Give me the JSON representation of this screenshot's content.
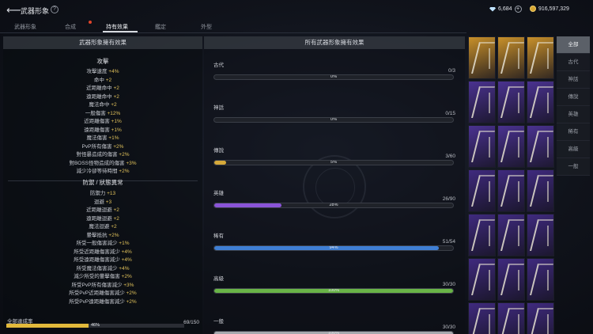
{
  "header": {
    "back_icon": "arrow-left-icon",
    "title": "武器形象",
    "help": "?",
    "diamonds": "6,684",
    "gold": "916,597,329"
  },
  "tabs": [
    {
      "label": "武器形象",
      "active": false
    },
    {
      "label": "合成",
      "active": false
    },
    {
      "label": "持有效果",
      "active": true
    },
    {
      "label": "鑑定",
      "active": false
    },
    {
      "label": "外型",
      "active": false
    }
  ],
  "left_panel": {
    "header": "武器形象擁有效果",
    "attack": {
      "title": "攻擊",
      "stats": [
        {
          "name": "攻擊速度",
          "value": "+4%"
        },
        {
          "name": "命中",
          "value": "+2"
        },
        {
          "name": "近距離命中",
          "value": "+2"
        },
        {
          "name": "遠距離命中",
          "value": "+2"
        },
        {
          "name": "魔法命中",
          "value": "+2"
        },
        {
          "name": "一般傷害",
          "value": "+12%"
        },
        {
          "name": "近距離傷害",
          "value": "+1%"
        },
        {
          "name": "遠距離傷害",
          "value": "+1%"
        },
        {
          "name": "魔法傷害",
          "value": "+1%"
        },
        {
          "name": "PvP所有傷害",
          "value": "+2%"
        },
        {
          "name": "對怪暴造成的傷害",
          "value": "+2%"
        },
        {
          "name": "對BOSS怪物造成的傷害",
          "value": "+3%"
        },
        {
          "name": "減少冷卻等待時間",
          "value": "+2%"
        }
      ]
    },
    "defense": {
      "title": "防禦 / 狀態異常",
      "stats": [
        {
          "name": "防禦力",
          "value": "+13"
        },
        {
          "name": "迴避",
          "value": "+3"
        },
        {
          "name": "近距離迴避",
          "value": "+2"
        },
        {
          "name": "遠距離迴避",
          "value": "+2"
        },
        {
          "name": "魔法迴避",
          "value": "+2"
        },
        {
          "name": "暈擊抵抗",
          "value": "+2%"
        },
        {
          "name": "所受一般傷害減少",
          "value": "+1%"
        },
        {
          "name": "所受近距離傷害減少",
          "value": "+4%"
        },
        {
          "name": "所受遠距離傷害減少",
          "value": "+4%"
        },
        {
          "name": "所受魔法傷害減少",
          "value": "+4%"
        },
        {
          "name": "減少所受的暈擊傷害",
          "value": "+2%"
        },
        {
          "name": "所受PvP所有傷害減少",
          "value": "+3%"
        },
        {
          "name": "所受PvP近距離傷害減少",
          "value": "+2%"
        },
        {
          "name": "所受PvP遠距離傷害減少",
          "value": "+2%"
        }
      ]
    },
    "overall": {
      "label": "全部達成率",
      "count": "69/150",
      "percent": "46%",
      "fraction": 0.46
    }
  },
  "middle_panel": {
    "header": "所有武器形象擁有效果",
    "rarities": [
      {
        "name": "古代",
        "count": "0/3",
        "percent": "0%",
        "fraction": 0.0,
        "color": "#8a8f99"
      },
      {
        "name": "神話",
        "count": "0/15",
        "percent": "0%",
        "fraction": 0.0,
        "color": "#8a8f99"
      },
      {
        "name": "傳說",
        "count": "3/60",
        "percent": "5%",
        "fraction": 0.05,
        "color": "#d6a93a"
      },
      {
        "name": "英雄",
        "count": "26/90",
        "percent": "28%",
        "fraction": 0.28,
        "color": "#8a54d8"
      },
      {
        "name": "稀有",
        "count": "51/54",
        "percent": "94%",
        "fraction": 0.94,
        "color": "#3f7fd4"
      },
      {
        "name": "高級",
        "count": "30/30",
        "percent": "100%",
        "fraction": 1.0,
        "color": "#69b447"
      },
      {
        "name": "一般",
        "count": "30/30",
        "percent": "100%",
        "fraction": 1.0,
        "color": "#a6a9ae"
      }
    ]
  },
  "weapon_grid": {
    "rows": [
      {
        "rarity": "legendary",
        "color": "#c8902a"
      },
      {
        "rarity": "heroic",
        "color": "#4a3290"
      },
      {
        "rarity": "heroic",
        "color": "#4a3290"
      },
      {
        "rarity": "heroic",
        "color": "#3f2a7e"
      },
      {
        "rarity": "heroic",
        "color": "#3f2a7e"
      },
      {
        "rarity": "heroic",
        "color": "#3f2a7e"
      },
      {
        "rarity": "heroic",
        "color": "#3f2a7e"
      }
    ]
  },
  "sidebar": {
    "items": [
      {
        "label": "全部",
        "active": true
      },
      {
        "label": "古代",
        "active": false
      },
      {
        "label": "神話",
        "active": false
      },
      {
        "label": "傳說",
        "active": false
      },
      {
        "label": "英雄",
        "active": false
      },
      {
        "label": "稀有",
        "active": false
      },
      {
        "label": "高級",
        "active": false
      },
      {
        "label": "一般",
        "active": false
      }
    ]
  }
}
